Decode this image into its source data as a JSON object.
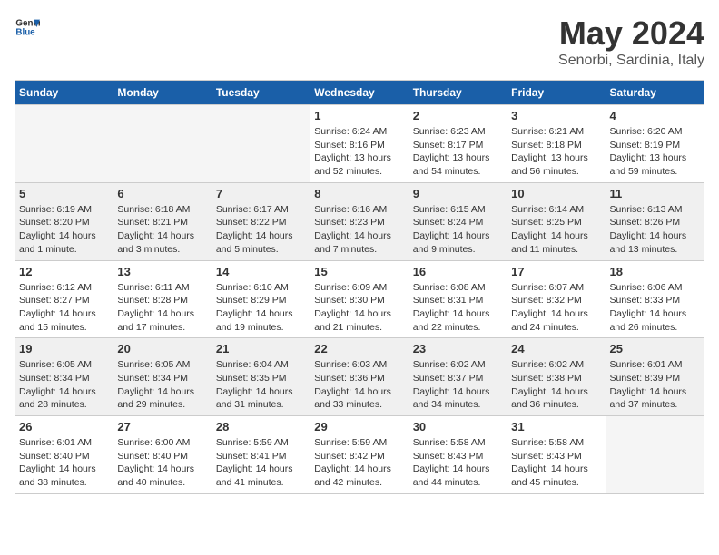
{
  "header": {
    "logo_general": "General",
    "logo_blue": "Blue",
    "month_year": "May 2024",
    "location": "Senorbi, Sardinia, Italy"
  },
  "weekdays": [
    "Sunday",
    "Monday",
    "Tuesday",
    "Wednesday",
    "Thursday",
    "Friday",
    "Saturday"
  ],
  "weeks": [
    [
      {
        "day": "",
        "info": ""
      },
      {
        "day": "",
        "info": ""
      },
      {
        "day": "",
        "info": ""
      },
      {
        "day": "1",
        "info": "Sunrise: 6:24 AM\nSunset: 8:16 PM\nDaylight: 13 hours\nand 52 minutes."
      },
      {
        "day": "2",
        "info": "Sunrise: 6:23 AM\nSunset: 8:17 PM\nDaylight: 13 hours\nand 54 minutes."
      },
      {
        "day": "3",
        "info": "Sunrise: 6:21 AM\nSunset: 8:18 PM\nDaylight: 13 hours\nand 56 minutes."
      },
      {
        "day": "4",
        "info": "Sunrise: 6:20 AM\nSunset: 8:19 PM\nDaylight: 13 hours\nand 59 minutes."
      }
    ],
    [
      {
        "day": "5",
        "info": "Sunrise: 6:19 AM\nSunset: 8:20 PM\nDaylight: 14 hours\nand 1 minute."
      },
      {
        "day": "6",
        "info": "Sunrise: 6:18 AM\nSunset: 8:21 PM\nDaylight: 14 hours\nand 3 minutes."
      },
      {
        "day": "7",
        "info": "Sunrise: 6:17 AM\nSunset: 8:22 PM\nDaylight: 14 hours\nand 5 minutes."
      },
      {
        "day": "8",
        "info": "Sunrise: 6:16 AM\nSunset: 8:23 PM\nDaylight: 14 hours\nand 7 minutes."
      },
      {
        "day": "9",
        "info": "Sunrise: 6:15 AM\nSunset: 8:24 PM\nDaylight: 14 hours\nand 9 minutes."
      },
      {
        "day": "10",
        "info": "Sunrise: 6:14 AM\nSunset: 8:25 PM\nDaylight: 14 hours\nand 11 minutes."
      },
      {
        "day": "11",
        "info": "Sunrise: 6:13 AM\nSunset: 8:26 PM\nDaylight: 14 hours\nand 13 minutes."
      }
    ],
    [
      {
        "day": "12",
        "info": "Sunrise: 6:12 AM\nSunset: 8:27 PM\nDaylight: 14 hours\nand 15 minutes."
      },
      {
        "day": "13",
        "info": "Sunrise: 6:11 AM\nSunset: 8:28 PM\nDaylight: 14 hours\nand 17 minutes."
      },
      {
        "day": "14",
        "info": "Sunrise: 6:10 AM\nSunset: 8:29 PM\nDaylight: 14 hours\nand 19 minutes."
      },
      {
        "day": "15",
        "info": "Sunrise: 6:09 AM\nSunset: 8:30 PM\nDaylight: 14 hours\nand 21 minutes."
      },
      {
        "day": "16",
        "info": "Sunrise: 6:08 AM\nSunset: 8:31 PM\nDaylight: 14 hours\nand 22 minutes."
      },
      {
        "day": "17",
        "info": "Sunrise: 6:07 AM\nSunset: 8:32 PM\nDaylight: 14 hours\nand 24 minutes."
      },
      {
        "day": "18",
        "info": "Sunrise: 6:06 AM\nSunset: 8:33 PM\nDaylight: 14 hours\nand 26 minutes."
      }
    ],
    [
      {
        "day": "19",
        "info": "Sunrise: 6:05 AM\nSunset: 8:34 PM\nDaylight: 14 hours\nand 28 minutes."
      },
      {
        "day": "20",
        "info": "Sunrise: 6:05 AM\nSunset: 8:34 PM\nDaylight: 14 hours\nand 29 minutes."
      },
      {
        "day": "21",
        "info": "Sunrise: 6:04 AM\nSunset: 8:35 PM\nDaylight: 14 hours\nand 31 minutes."
      },
      {
        "day": "22",
        "info": "Sunrise: 6:03 AM\nSunset: 8:36 PM\nDaylight: 14 hours\nand 33 minutes."
      },
      {
        "day": "23",
        "info": "Sunrise: 6:02 AM\nSunset: 8:37 PM\nDaylight: 14 hours\nand 34 minutes."
      },
      {
        "day": "24",
        "info": "Sunrise: 6:02 AM\nSunset: 8:38 PM\nDaylight: 14 hours\nand 36 minutes."
      },
      {
        "day": "25",
        "info": "Sunrise: 6:01 AM\nSunset: 8:39 PM\nDaylight: 14 hours\nand 37 minutes."
      }
    ],
    [
      {
        "day": "26",
        "info": "Sunrise: 6:01 AM\nSunset: 8:40 PM\nDaylight: 14 hours\nand 38 minutes."
      },
      {
        "day": "27",
        "info": "Sunrise: 6:00 AM\nSunset: 8:40 PM\nDaylight: 14 hours\nand 40 minutes."
      },
      {
        "day": "28",
        "info": "Sunrise: 5:59 AM\nSunset: 8:41 PM\nDaylight: 14 hours\nand 41 minutes."
      },
      {
        "day": "29",
        "info": "Sunrise: 5:59 AM\nSunset: 8:42 PM\nDaylight: 14 hours\nand 42 minutes."
      },
      {
        "day": "30",
        "info": "Sunrise: 5:58 AM\nSunset: 8:43 PM\nDaylight: 14 hours\nand 44 minutes."
      },
      {
        "day": "31",
        "info": "Sunrise: 5:58 AM\nSunset: 8:43 PM\nDaylight: 14 hours\nand 45 minutes."
      },
      {
        "day": "",
        "info": ""
      }
    ]
  ]
}
